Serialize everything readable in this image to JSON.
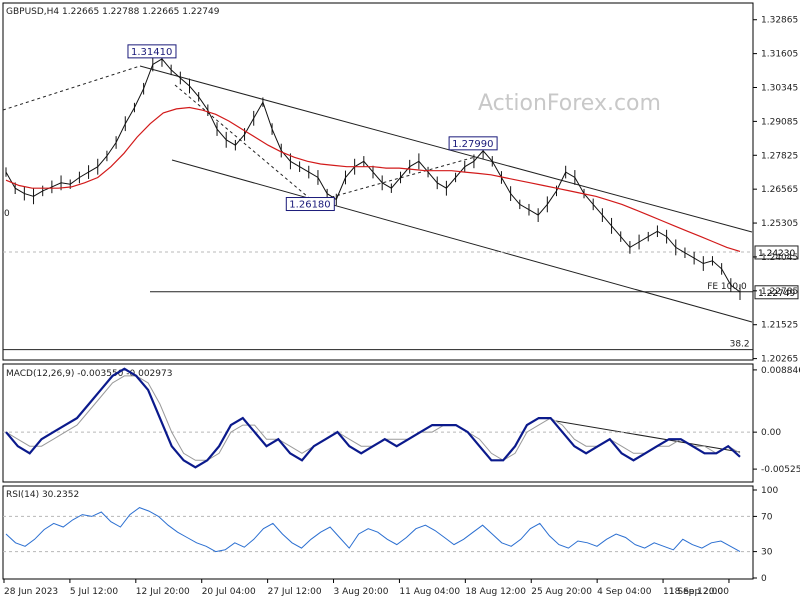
{
  "chart_data": {
    "type": "line",
    "title": "GBPUSD,H4  1.22665 1.22788 1.22665 1.22749",
    "watermark": "ActionForex.com",
    "x_labels": [
      "28 Jun 2023",
      "5 Jul 12:00",
      "12 Jul 20:00",
      "20 Jul 04:00",
      "27 Jul 12:00",
      "3 Aug 20:00",
      "11 Aug 04:00",
      "18 Aug 12:00",
      "25 Aug 20:00",
      "4 Sep 04:00",
      "11 Sep 12:00",
      "18 Sep 20:00"
    ],
    "price_panel": {
      "ylim": [
        1.2025,
        1.3345
      ],
      "y_ticks": [
        "1.32865",
        "1.31605",
        "1.30345",
        "1.29085",
        "1.27825",
        "1.26565",
        "1.25305",
        "1.24045",
        "1.22785",
        "1.21525",
        "1.20265"
      ],
      "price": [
        1.272,
        1.266,
        1.264,
        1.263,
        1.265,
        1.2665,
        1.268,
        1.2675,
        1.27,
        1.272,
        1.274,
        1.278,
        1.283,
        1.29,
        1.296,
        1.303,
        1.312,
        1.3141,
        1.31,
        1.307,
        1.304,
        1.3,
        1.295,
        1.288,
        1.284,
        1.282,
        1.286,
        1.292,
        1.298,
        1.288,
        1.28,
        1.276,
        1.274,
        1.272,
        1.27,
        1.264,
        1.2618,
        1.27,
        1.274,
        1.276,
        1.272,
        1.268,
        1.266,
        1.27,
        1.274,
        1.276,
        1.272,
        1.268,
        1.266,
        1.27,
        1.274,
        1.276,
        1.2799,
        1.276,
        1.27,
        1.264,
        1.26,
        1.258,
        1.256,
        1.26,
        1.265,
        1.272,
        1.27,
        1.264,
        1.26,
        1.256,
        1.252,
        1.248,
        1.244,
        1.246,
        1.248,
        1.25,
        1.248,
        1.244,
        1.242,
        1.24,
        1.238,
        1.239,
        1.236,
        1.23,
        1.2274
      ],
      "ma": [
        1.269,
        1.267,
        1.266,
        1.266,
        1.266,
        1.2665,
        1.268,
        1.27,
        1.274,
        1.279,
        1.285,
        1.29,
        1.294,
        1.2955,
        1.296,
        1.295,
        1.2935,
        1.291,
        1.288,
        1.285,
        1.282,
        1.2795,
        1.2775,
        1.276,
        1.275,
        1.2745,
        1.274,
        1.274,
        1.274,
        1.2735,
        1.2735,
        1.273,
        1.2725,
        1.2725,
        1.2725,
        1.272,
        1.2715,
        1.271,
        1.27,
        1.269,
        1.268,
        1.267,
        1.266,
        1.265,
        1.264,
        1.263,
        1.2615,
        1.26,
        1.258,
        1.256,
        1.254,
        1.252,
        1.25,
        1.248,
        1.246,
        1.244,
        1.2425
      ],
      "labels": [
        {
          "text": "1.31410",
          "x": 17,
          "y": 1.3141
        },
        {
          "text": "1.26180",
          "x": 36,
          "y": 1.2618
        },
        {
          "text": "1.27990",
          "x": 52,
          "y": 1.2799
        }
      ],
      "level_tags": [
        {
          "text": "1.24230",
          "value": 1.2423
        },
        {
          "text": "1.22749",
          "value": 1.22749
        }
      ],
      "level_notes": [
        {
          "text": "FE 100.0",
          "value": 1.2275
        },
        {
          "text": "38.2",
          "value": 1.206
        }
      ],
      "left_cut_label": "0"
    },
    "macd_panel": {
      "title": "MACD(12,26,9) -0.003550 -0.002973",
      "ylim": [
        -0.0068,
        0.0094
      ],
      "y_ticks": [
        "0.008846",
        "0.00",
        "-0.005252"
      ],
      "macd": [
        0.0,
        -0.002,
        -0.003,
        -0.001,
        0.0,
        0.001,
        0.002,
        0.004,
        0.006,
        0.008,
        0.009,
        0.008,
        0.006,
        0.002,
        -0.002,
        -0.004,
        -0.005,
        -0.004,
        -0.002,
        0.001,
        0.002,
        0.0,
        -0.002,
        -0.001,
        -0.003,
        -0.004,
        -0.002,
        -0.001,
        0.0,
        -0.002,
        -0.003,
        -0.002,
        -0.001,
        -0.002,
        -0.001,
        0.0,
        0.001,
        0.001,
        0.001,
        0.0,
        -0.002,
        -0.004,
        -0.004,
        -0.002,
        0.001,
        0.002,
        0.002,
        0.0,
        -0.002,
        -0.003,
        -0.002,
        -0.001,
        -0.003,
        -0.004,
        -0.003,
        -0.002,
        -0.001,
        -0.001,
        -0.002,
        -0.003,
        -0.003,
        -0.002,
        -0.0035
      ],
      "signal": [
        0.0,
        -0.001,
        -0.002,
        -0.002,
        -0.001,
        0.0,
        0.001,
        0.003,
        0.005,
        0.007,
        0.008,
        0.008,
        0.007,
        0.004,
        0.0,
        -0.003,
        -0.004,
        -0.004,
        -0.003,
        0.0,
        0.001,
        0.001,
        -0.001,
        -0.001,
        -0.002,
        -0.003,
        -0.002,
        -0.001,
        0.0,
        -0.001,
        -0.002,
        -0.002,
        -0.001,
        -0.001,
        -0.001,
        0.0,
        0.0,
        0.001,
        0.001,
        0.0,
        -0.001,
        -0.003,
        -0.004,
        -0.003,
        0.0,
        0.001,
        0.002,
        0.001,
        -0.001,
        -0.002,
        -0.002,
        -0.001,
        -0.002,
        -0.003,
        -0.003,
        -0.002,
        -0.002,
        -0.001,
        -0.002,
        -0.002,
        -0.003,
        -0.002,
        -0.002973
      ]
    },
    "rsi_panel": {
      "title": "RSI(14) 30.2352",
      "ylim": [
        0,
        100
      ],
      "y_ticks": [
        "100",
        "70",
        "30",
        "0"
      ],
      "levels": [
        70,
        30
      ],
      "rsi": [
        50,
        40,
        36,
        44,
        55,
        62,
        58,
        66,
        72,
        70,
        75,
        64,
        58,
        72,
        80,
        76,
        70,
        60,
        52,
        46,
        40,
        36,
        30,
        32,
        40,
        35,
        44,
        56,
        62,
        50,
        40,
        34,
        44,
        52,
        58,
        46,
        34,
        50,
        56,
        52,
        44,
        38,
        46,
        56,
        60,
        54,
        46,
        38,
        44,
        52,
        60,
        50,
        40,
        36,
        44,
        56,
        62,
        48,
        38,
        34,
        42,
        40,
        36,
        44,
        50,
        46,
        38,
        34,
        40,
        36,
        32,
        44,
        38,
        34,
        40,
        42,
        36,
        30
      ]
    }
  }
}
